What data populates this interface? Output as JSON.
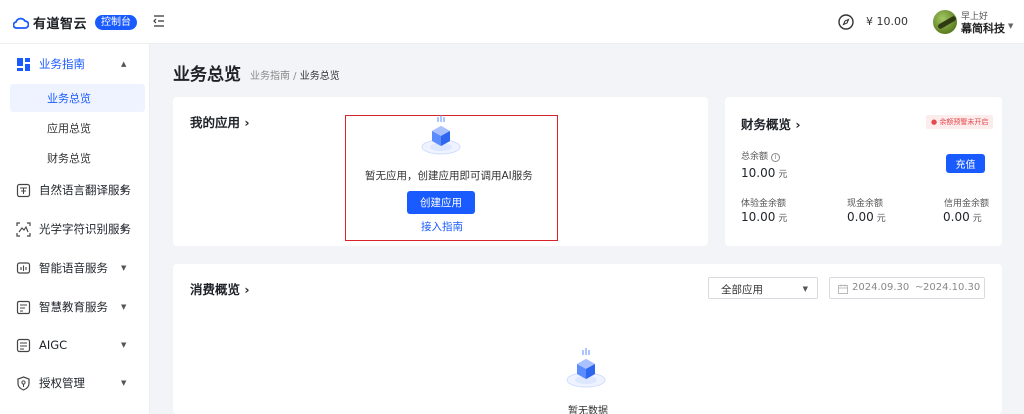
{
  "header": {
    "logo_text": "有道智云",
    "console_badge": "控制台",
    "balance": "¥ 10.00",
    "greeting": "早上好",
    "company": "幕简科技"
  },
  "sidebar": {
    "groups": [
      {
        "label": "业务指南",
        "icon": "dashboard-grid-icon",
        "expanded": true,
        "items": [
          {
            "label": "业务总览",
            "active": true
          },
          {
            "label": "应用总览"
          },
          {
            "label": "财务总览"
          }
        ]
      },
      {
        "label": "自然语言翻译服务",
        "icon": "translate-icon"
      },
      {
        "label": "光学字符识别服务",
        "icon": "scan-icon"
      },
      {
        "label": "智能语音服务",
        "icon": "voice-icon"
      },
      {
        "label": "智慧教育服务",
        "icon": "education-icon"
      },
      {
        "label": "AIGC",
        "icon": "aigc-icon"
      },
      {
        "label": "授权管理",
        "icon": "shield-key-icon"
      }
    ]
  },
  "page": {
    "title": "业务总览",
    "breadcrumb_parent": "业务指南",
    "breadcrumb_sep": " / ",
    "breadcrumb_current": "业务总览"
  },
  "apps": {
    "title": "我的应用",
    "empty_message": "暂无应用，创建应用即可调用AI服务",
    "create_button": "创建应用",
    "guide_link": "接入指南"
  },
  "finance": {
    "title": "财务概览",
    "alert_tag": "● 余额预警未开启",
    "balance_label": "总余额",
    "balance_value": "10.00",
    "unit": "元",
    "recharge_button": "充值",
    "breakdown": [
      {
        "label": "体验金余额",
        "value": "10.00"
      },
      {
        "label": "现金余额",
        "value": "0.00"
      },
      {
        "label": "信用金余额",
        "value": "0.00"
      }
    ]
  },
  "consumption": {
    "title": "消费概览",
    "app_select": "全部应用",
    "date_start": "2024.09.30",
    "date_sep": "~",
    "date_end": "2024.10.30",
    "empty_message": "暂无数据"
  },
  "colors": {
    "accent": "#1a5bff",
    "highlight_border": "#d9232b",
    "alert": "#e5484d"
  }
}
